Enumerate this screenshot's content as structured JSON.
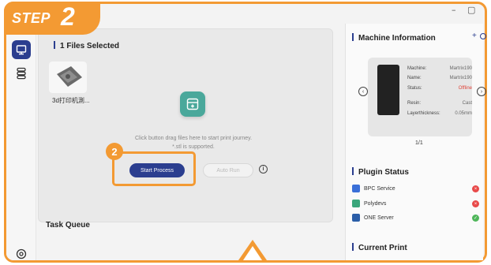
{
  "step": {
    "word": "STEP",
    "number": "2"
  },
  "badge": {
    "number": "2"
  },
  "window_controls": {
    "minimize": "–",
    "maximize": "▢"
  },
  "files": {
    "title": "1 Files Selected",
    "items": [
      {
        "name": "3d打印机測..."
      }
    ]
  },
  "upload": {
    "hint_line1": "Click button drag files here to start print journey.",
    "hint_line2": "*.stl is supported."
  },
  "actions": {
    "start_label": "Start Process",
    "auto_label": "Auto Run",
    "info_symbol": "i"
  },
  "task_queue": {
    "title": "Task Queue"
  },
  "machine": {
    "title": "Machine Information",
    "rows": [
      {
        "label": "Machine:",
        "value": "Martrix190"
      },
      {
        "label": "Name:",
        "value": "Martrix190"
      },
      {
        "label": "Status:",
        "value": "Offline"
      },
      {
        "label": "Resin:",
        "value": "Cast"
      },
      {
        "label": "Layerthickness:",
        "value": "0.05mm"
      }
    ],
    "pager": "1/1",
    "colors": {
      "offline": "#e0443a",
      "accent": "#2b3e8f"
    }
  },
  "plugins": {
    "title": "Plugin Status",
    "items": [
      {
        "name": "BPC Service",
        "status": "error"
      },
      {
        "name": "Polydevs",
        "status": "error"
      },
      {
        "name": "ONE Server",
        "status": "ok"
      }
    ]
  },
  "current_print": {
    "title": "Current Print"
  },
  "colors": {
    "highlight": "#f39a33",
    "primary": "#2b3e8f",
    "upload": "#4aa89b"
  }
}
